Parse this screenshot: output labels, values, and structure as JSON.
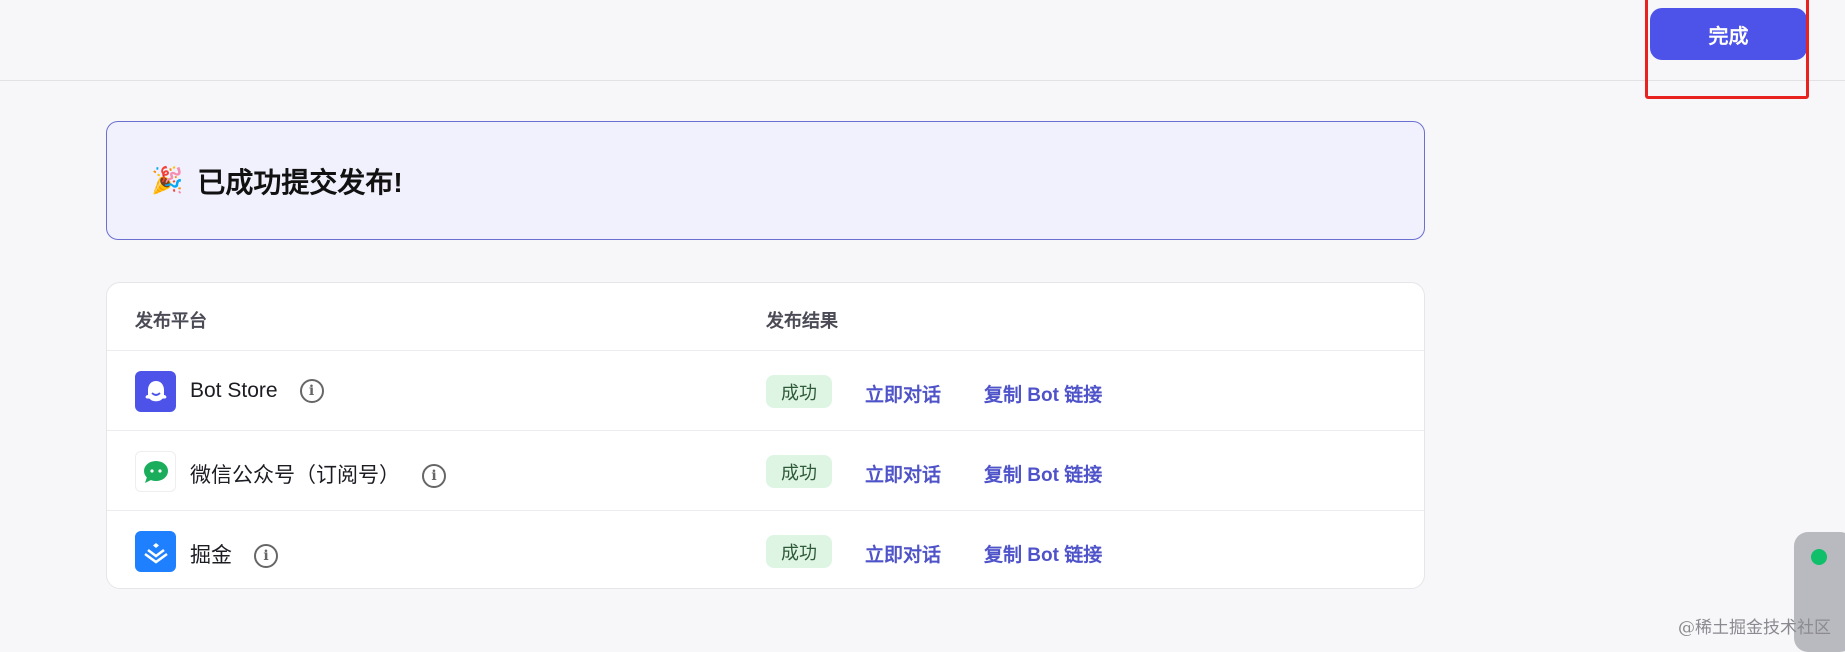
{
  "header": {
    "done_label": "完成"
  },
  "banner": {
    "emoji": "🎉",
    "title": "已成功提交发布!"
  },
  "table": {
    "columns": [
      "发布平台",
      "发布结果"
    ],
    "rows": [
      {
        "platform": "Bot Store",
        "icon": "ghost-icon",
        "status": "成功",
        "action1": "立即对话",
        "action2": "复制 Bot 链接"
      },
      {
        "platform": "微信公众号（订阅号）",
        "icon": "wechat-icon",
        "status": "成功",
        "action1": "立即对话",
        "action2": "复制 Bot 链接"
      },
      {
        "platform": "掘金",
        "icon": "juejin-icon",
        "status": "成功",
        "action1": "立即对话",
        "action2": "复制 Bot 链接"
      }
    ]
  },
  "watermark": "@稀土掘金技术社区",
  "colors": {
    "accent": "#4d53e8",
    "link": "#4f53c9",
    "success_bg": "#def5e4",
    "highlight": "#e8231f"
  }
}
